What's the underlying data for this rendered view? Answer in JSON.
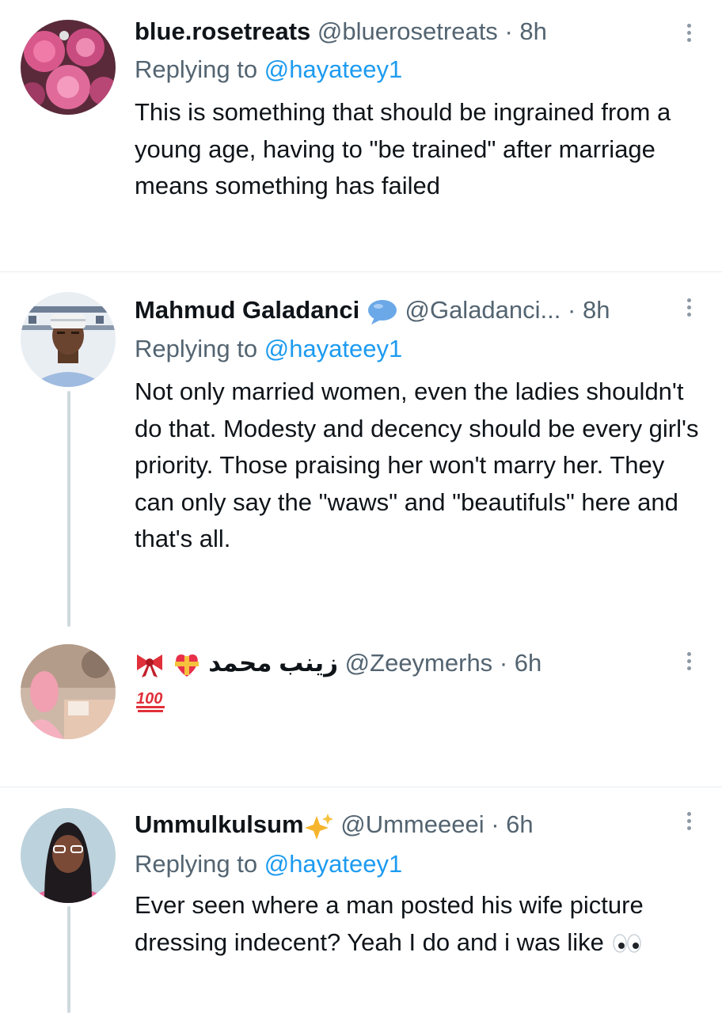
{
  "tweets": [
    {
      "name": "blue.rosetreats",
      "handle": "@bluerosetreats",
      "time": "8h",
      "replying_prefix": "Replying to ",
      "replying_to": "@hayateey1",
      "text": "This is something that should be ingrained from a young age, having to \"be trained\" after marriage means something has failed"
    },
    {
      "name": "Mahmud Galadanci",
      "badge_icon": "speech-bubble-icon",
      "handle": "@Galadanci...",
      "time": "8h",
      "replying_prefix": "Replying to ",
      "replying_to": "@hayateey1",
      "text": "Not only married women, even the ladies shouldn't do that. Modesty and decency should be every girl's priority. Those praising her won't marry her. They can only say the \"waws\" and \"beautifuls\" here and that's all."
    },
    {
      "name": "زينب محمد",
      "name_emojis": [
        "ribbon-icon",
        "heart-with-ribbon-icon"
      ],
      "handle": "@Zeeymerhs",
      "time": "6h",
      "text_emoji": "hundred-points-icon"
    },
    {
      "name": "Ummulkulsum",
      "badge_icon": "sparkles-icon",
      "handle": "@Ummeeeei",
      "time": "6h",
      "replying_prefix": "Replying to ",
      "replying_to": "@hayateey1",
      "text": "Ever seen where a man posted his wife picture dressing indecent? Yeah I do and i was like",
      "text_emoji": "eyes-icon"
    }
  ],
  "separator": "·",
  "colors": {
    "link": "#1d9bf0",
    "secondary": "#536471",
    "divider": "#e6ecf0",
    "thread_line": "#cfd9de"
  }
}
